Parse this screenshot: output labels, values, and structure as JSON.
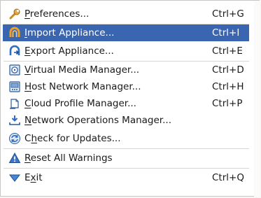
{
  "menu": {
    "items": [
      {
        "id": "preferences",
        "pre": "",
        "mn": "P",
        "post": "references...",
        "shortcut": "Ctrl+G",
        "icon": "wrench-icon"
      },
      {
        "id": "import-appliance",
        "pre": "",
        "mn": "I",
        "post": "mport Appliance...",
        "shortcut": "Ctrl+I",
        "icon": "import-appliance-icon",
        "highlighted": true
      },
      {
        "id": "export-appliance",
        "pre": "",
        "mn": "E",
        "post": "xport Appliance...",
        "shortcut": "Ctrl+E",
        "icon": "export-appliance-icon"
      },
      {
        "id": "virtual-media-manager",
        "pre": "",
        "mn": "V",
        "post": "irtual Media Manager...",
        "shortcut": "Ctrl+D",
        "icon": "virtual-media-icon"
      },
      {
        "id": "host-network-manager",
        "pre": "",
        "mn": "H",
        "post": "ost Network Manager...",
        "shortcut": "Ctrl+H",
        "icon": "host-network-icon"
      },
      {
        "id": "cloud-profile-manager",
        "pre": "",
        "mn": "C",
        "post": "loud Profile Manager...",
        "shortcut": "Ctrl+P",
        "icon": "cloud-profile-icon"
      },
      {
        "id": "network-operations-manager",
        "pre": "",
        "mn": "N",
        "post": "etwork Operations Manager...",
        "shortcut": "",
        "icon": "network-operations-icon"
      },
      {
        "id": "check-for-updates",
        "pre": "C",
        "mn": "h",
        "post": "eck for Updates...",
        "shortcut": "",
        "icon": "refresh-icon"
      },
      {
        "id": "reset-all-warnings",
        "pre": "",
        "mn": "R",
        "post": "eset All Warnings",
        "shortcut": "",
        "icon": "warning-icon"
      },
      {
        "id": "exit",
        "pre": "E",
        "mn": "x",
        "post": "it",
        "shortcut": "Ctrl+Q",
        "icon": "exit-icon"
      }
    ]
  },
  "colors": {
    "highlight": "#3a66b1",
    "highlight_text": "#ffffff",
    "separator": "#d8d6d3",
    "menu_bg": "#ffffff"
  }
}
